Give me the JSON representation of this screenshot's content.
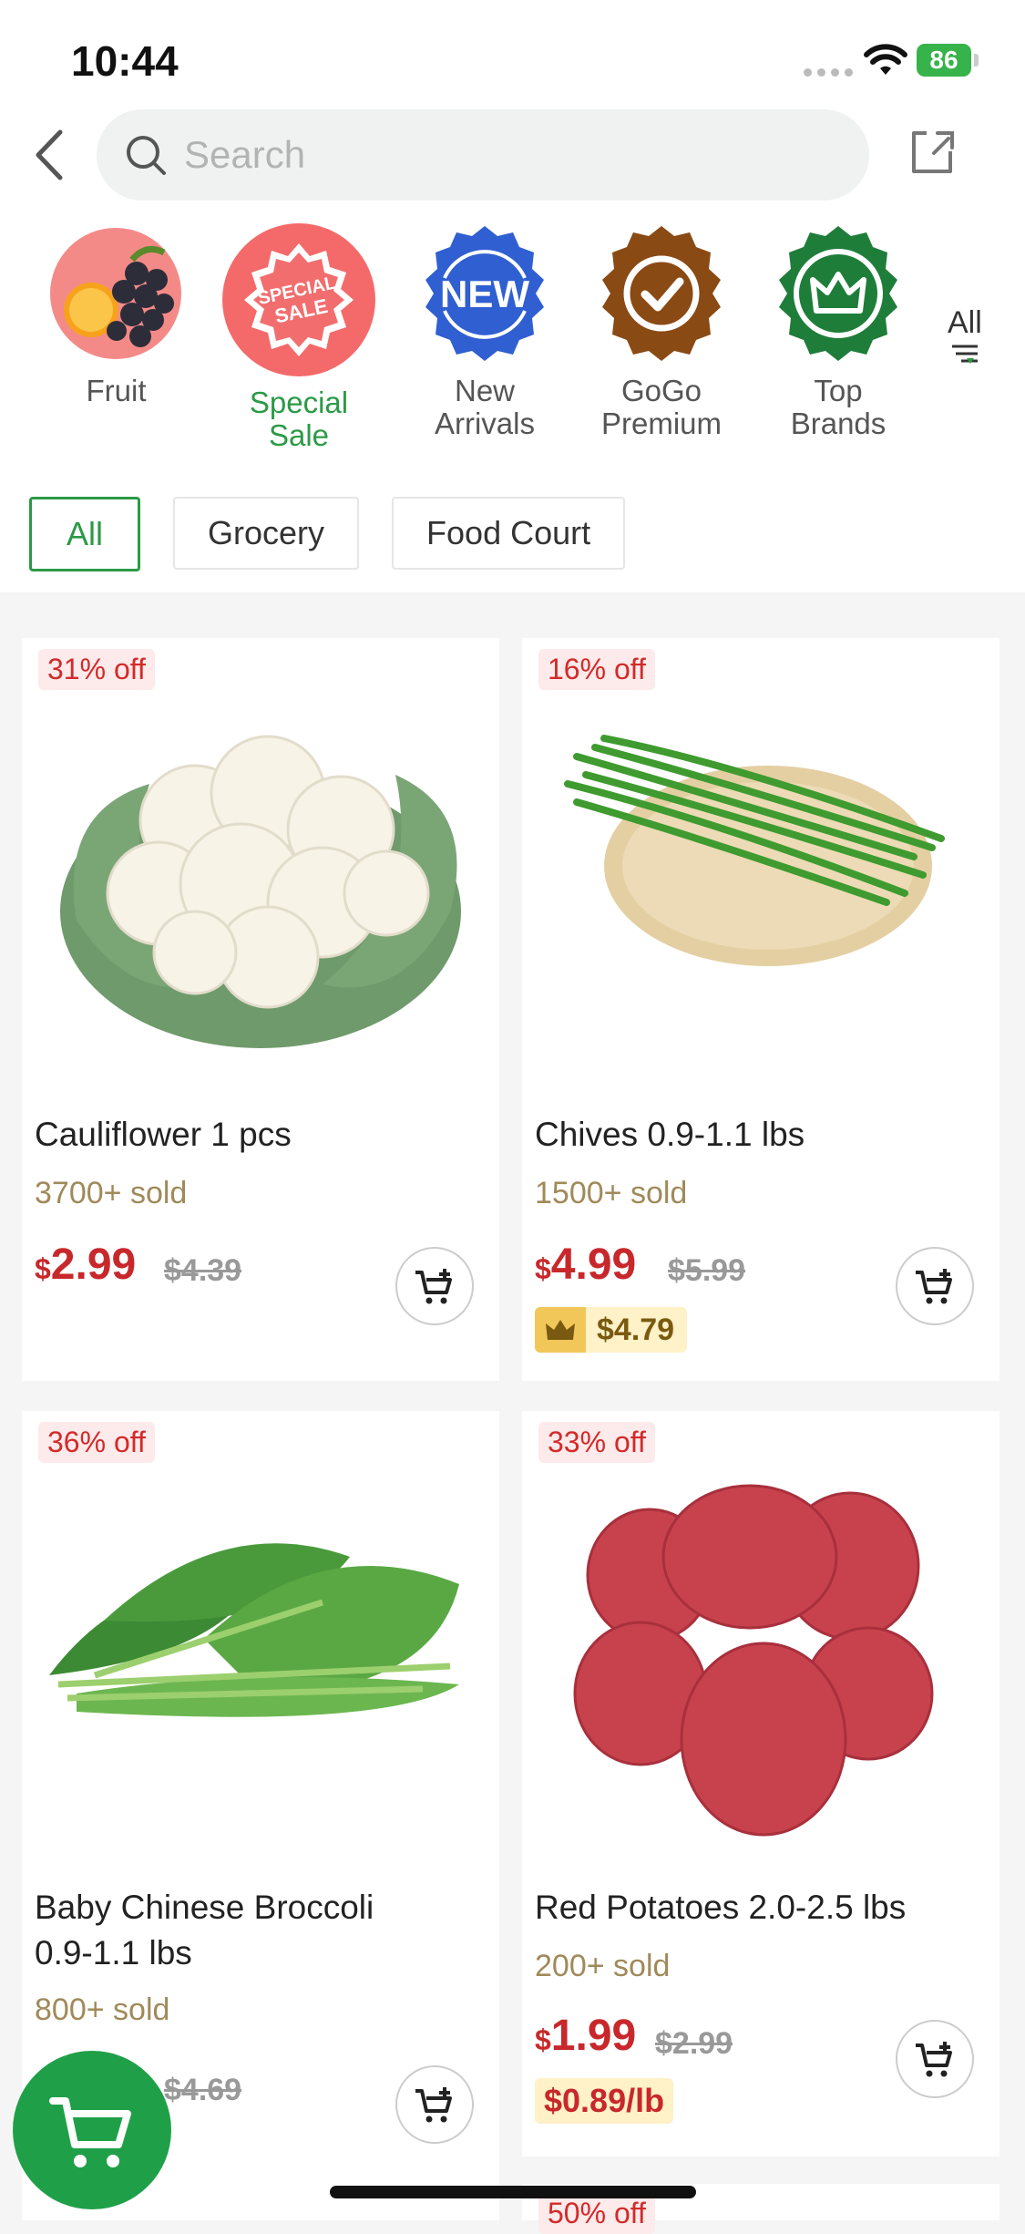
{
  "status_bar": {
    "time": "10:44",
    "battery": "86"
  },
  "search": {
    "placeholder": "Search"
  },
  "categories": [
    {
      "label": "Fruit"
    },
    {
      "label": "Special Sale"
    },
    {
      "label_line1": "New",
      "label_line2": "Arrivals"
    },
    {
      "label_line1": "GoGo",
      "label_line2": "Premium"
    },
    {
      "label_line1": "Top",
      "label_line2": "Brands"
    }
  ],
  "special_badge": {
    "line1": "SPECIAL",
    "line2": "SALE"
  },
  "new_badge": {
    "text": "NEW"
  },
  "all_categories": {
    "label": "All"
  },
  "filters": [
    {
      "label": "All",
      "active": true
    },
    {
      "label": "Grocery"
    },
    {
      "label": "Food Court"
    }
  ],
  "products": [
    {
      "badge": "31% off",
      "name": "Cauliflower 1 pcs",
      "sold": "3700+ sold",
      "currency": "$",
      "price": "2.99",
      "old_price": "$4.39"
    },
    {
      "badge": "16% off",
      "name": "Chives 0.9-1.1 lbs",
      "sold": "1500+ sold",
      "currency": "$",
      "price": "4.99",
      "old_price": "$5.99",
      "member_price": "$4.79"
    },
    {
      "badge": "36% off",
      "name_line1": "Baby Chinese Broccoli",
      "name_line2": "0.9-1.1 lbs",
      "sold": "800+ sold",
      "old_price": "$4.69"
    },
    {
      "badge": "33% off",
      "name": "Red Potatoes 2.0-2.5 lbs",
      "sold": "200+ sold",
      "currency": "$",
      "price": "1.99",
      "old_price": "$2.99",
      "unit_price": "$0.89/lb"
    },
    {
      "badge": "50% off"
    }
  ],
  "colors": {
    "brand_green": "#2b9a46",
    "price_red": "#c8282b",
    "discount_bg": "#fdeaea"
  }
}
